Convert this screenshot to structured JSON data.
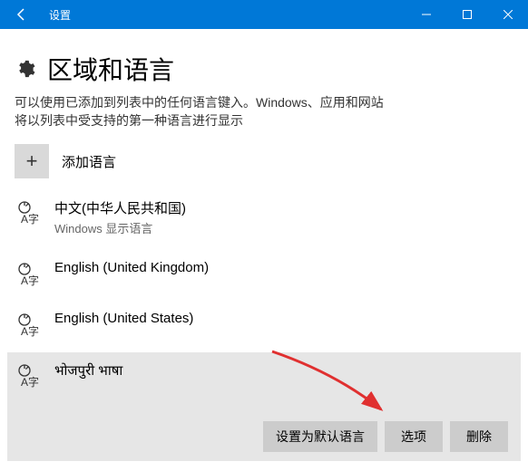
{
  "titlebar": {
    "title": "设置"
  },
  "page": {
    "title": "区域和语言",
    "description_line1": "可以使用已添加到列表中的任何语言键入。Windows、应用和网站",
    "description_line2": "将以列表中受支持的第一种语言进行显示"
  },
  "add": {
    "label": "添加语言"
  },
  "languages": [
    {
      "name": "中文(中华人民共和国)",
      "subtitle": "Windows 显示语言"
    },
    {
      "name": "English (United Kingdom)",
      "subtitle": ""
    },
    {
      "name": "English (United States)",
      "subtitle": ""
    },
    {
      "name": "भोजपुरी भाषा",
      "subtitle": ""
    }
  ],
  "buttons": {
    "set_default": "设置为默认语言",
    "options": "选项",
    "remove": "删除"
  }
}
